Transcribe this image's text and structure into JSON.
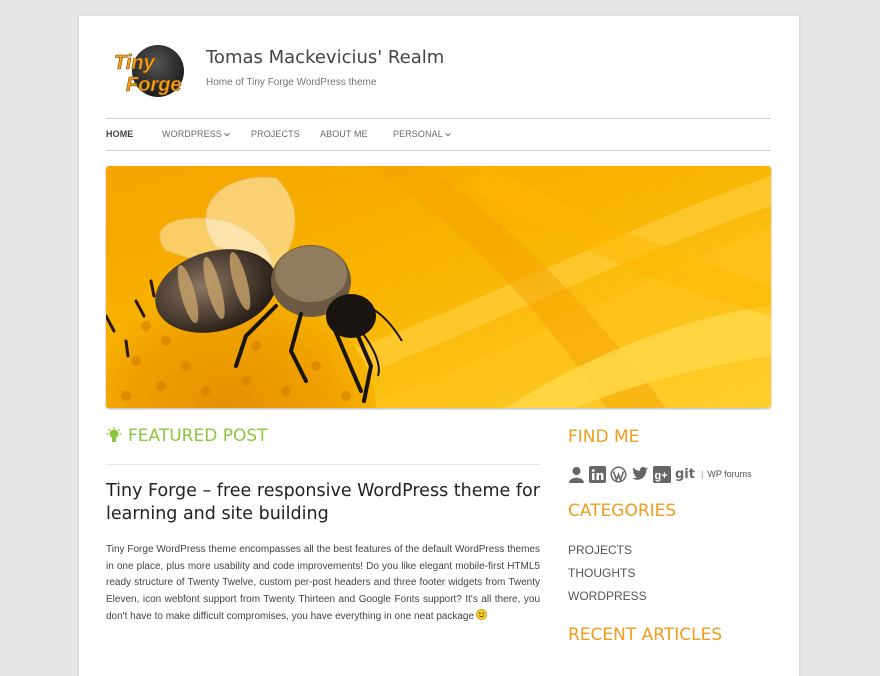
{
  "site": {
    "logo_line1": "Tiny",
    "logo_line2": "Forge",
    "title": "Tomas Mackevicius' Realm",
    "description": "Home of Tiny Forge WordPress theme"
  },
  "nav": {
    "items": [
      {
        "label": "HOME",
        "active": true,
        "has_submenu": false
      },
      {
        "label": "WORDPRESS",
        "active": false,
        "has_submenu": true
      },
      {
        "label": "PROJECTS",
        "active": false,
        "has_submenu": false
      },
      {
        "label": "ABOUT ME",
        "active": false,
        "has_submenu": false
      },
      {
        "label": "PERSONAL",
        "active": false,
        "has_submenu": true
      }
    ]
  },
  "featured": {
    "heading": "FEATURED POST",
    "post_title": "Tiny Forge – free responsive WordPress theme for learning and site building",
    "excerpt": "Tiny Forge WordPress theme encompasses all the best features of the default WordPress themes in one place, plus more usability and code improvements! Do you like elegant mo­bile-first HTML5 ready structure of Twenty Twelve, custom per-post headers and three footer widgets from Twenty Eleven, icon webfont support from Twenty Thirteen and Google Fonts support? It's all there, you don't have to make difficult compromises, you have everything in one neat package",
    "emoticon": "smiley-icon"
  },
  "sidebar": {
    "find_me": {
      "title": "FIND ME",
      "icons": [
        "user-icon",
        "linkedin-icon",
        "wordpress-icon",
        "twitter-icon",
        "google-plus-icon"
      ],
      "git_label": "git",
      "separator": "|",
      "link_label": "WP forums"
    },
    "categories": {
      "title": "CATEGORIES",
      "items": [
        "PROJECTS",
        "THOUGHTS",
        "WORDPRESS"
      ]
    },
    "recent": {
      "title": "RECENT ARTICLES"
    }
  },
  "colors": {
    "featured_green": "#8bc63e",
    "widget_orange": "#f39b1a",
    "page_bg": "#e6e6e6"
  }
}
